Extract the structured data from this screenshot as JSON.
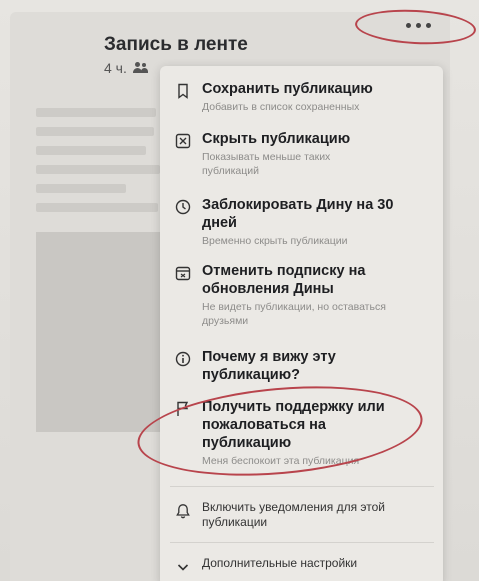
{
  "post": {
    "title": "Запись в ленте",
    "time": "4 ч."
  },
  "menu": {
    "items": [
      {
        "icon": "bookmark-icon",
        "label": "Сохранить публикацию",
        "description": "Добавить в список сохраненных"
      },
      {
        "icon": "hide-icon",
        "label": "Скрыть публикацию",
        "description": "Показывать меньше таких публикаций"
      },
      {
        "icon": "clock-icon",
        "label": "Заблокировать Дину на 30 дней",
        "description": "Временно скрыть публикации"
      },
      {
        "icon": "unfollow-icon",
        "label": "Отменить подписку на обновления Дины",
        "description": "Не видеть публикации, но оставаться друзьями"
      },
      {
        "icon": "info-icon",
        "label": "Почему я вижу эту публикацию?",
        "description": ""
      },
      {
        "icon": "report-icon",
        "label": "Получить поддержку или пожаловаться на публикацию",
        "description": "Меня беспокоит эта публикация"
      },
      {
        "icon": "bell-icon",
        "label": "Включить уведомления для этой публикации",
        "description": ""
      },
      {
        "icon": "chevron-down-icon",
        "label": "Дополнительные настройки",
        "description": ""
      }
    ]
  },
  "colors": {
    "annotation_ring": "#b8444c",
    "menu_background": "#ebe9e5"
  }
}
